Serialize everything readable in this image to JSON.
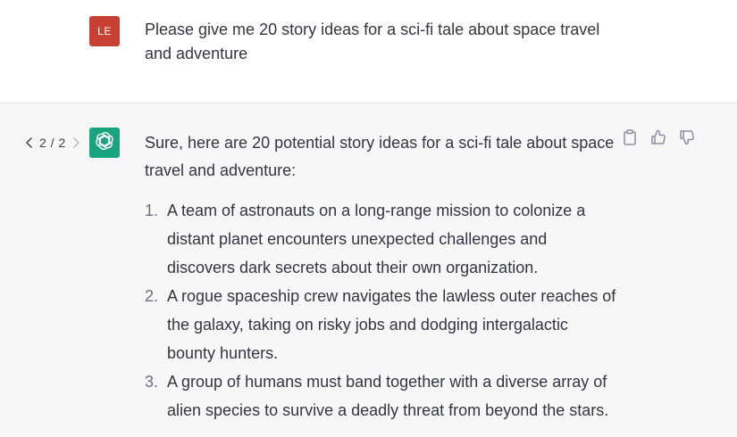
{
  "colors": {
    "user_avatar_bg": "#c83f34",
    "assistant_avatar_bg": "#19a37f",
    "assistant_row_bg": "#f7f7f8",
    "text": "#343541",
    "icon": "#8e8ea0"
  },
  "user": {
    "avatar_initials": "LE",
    "message": "Please give me 20 story ideas for a sci-fi tale about space travel and adventure"
  },
  "assistant": {
    "pager": {
      "prev_icon": "chevron-left-icon",
      "count": "2 / 2",
      "next_icon": "chevron-right-icon"
    },
    "avatar_icon": "openai-logo-icon",
    "intro": "Sure, here are 20 potential story ideas for a sci-fi tale about space travel and adventure:",
    "ideas": [
      {
        "num": "1.",
        "text": "A team of astronauts on a long-range mission to colonize a distant planet encounters unexpected challenges and discovers dark secrets about their own organization."
      },
      {
        "num": "2.",
        "text": "A rogue spaceship crew navigates the lawless outer reaches of the galaxy, taking on risky jobs and dodging intergalactic bounty hunters."
      },
      {
        "num": "3.",
        "text": "A group of humans must band together with a diverse array of alien species to survive a deadly threat from beyond the stars."
      }
    ],
    "actions": [
      {
        "name": "copy-button",
        "icon": "clipboard-icon"
      },
      {
        "name": "thumbs-up-button",
        "icon": "thumbs-up-icon"
      },
      {
        "name": "thumbs-down-button",
        "icon": "thumbs-down-icon"
      }
    ]
  }
}
